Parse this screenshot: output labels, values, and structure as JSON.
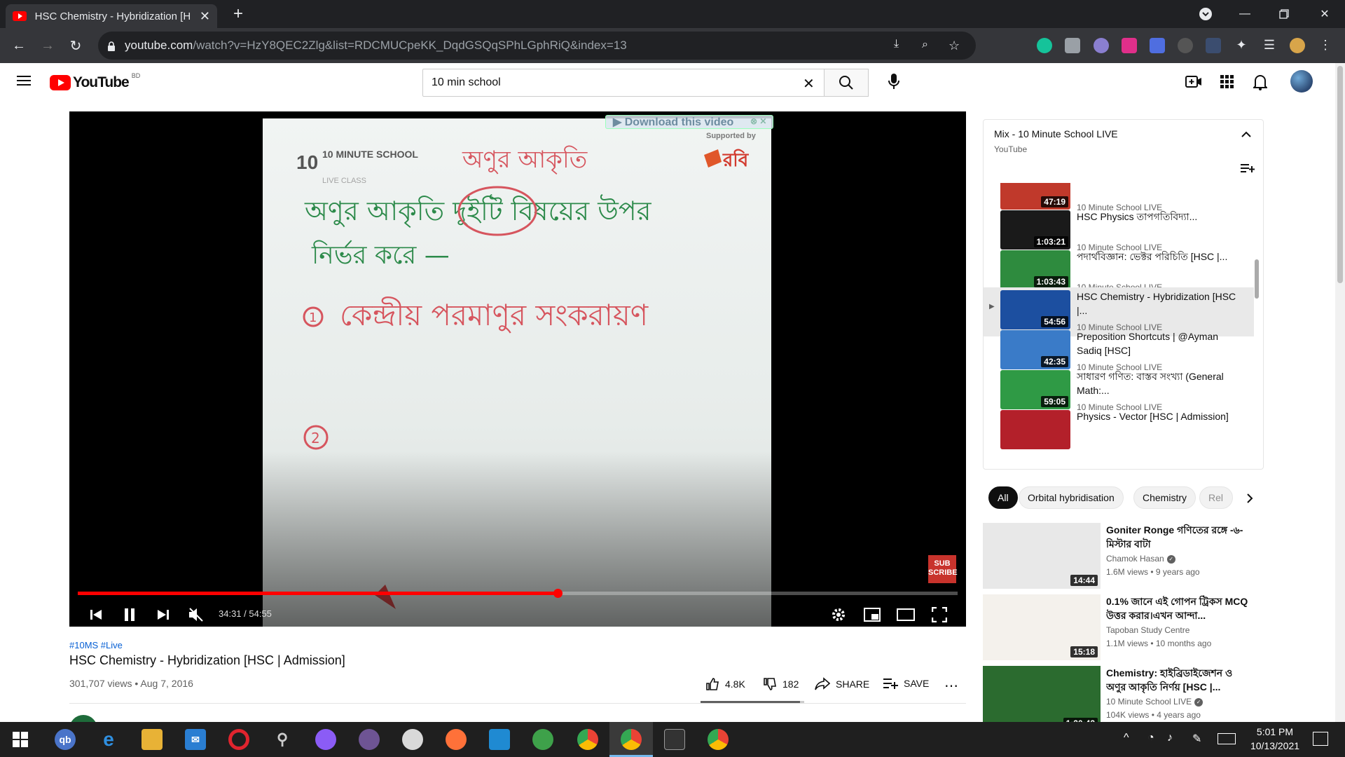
{
  "browser": {
    "tab_title": "HSC Chemistry - Hybridization [H",
    "url_host": "youtube.com",
    "url_path": "/watch?v=HzY8QEC2Zlg&list=RDCMUCpeKK_DqdGSQqSPhLGphRiQ&index=13"
  },
  "youtube": {
    "logo_text": "YouTube",
    "country_code": "BD",
    "search_value": "10 min school",
    "search_placeholder": "Search"
  },
  "player": {
    "download_text": "▶ Download this video",
    "current_time": "34:31 / 54:55",
    "progress": 0.545,
    "board_header_left": "10 MINUTE SCHOOL",
    "board_header_left_sub": "LIVE CLASS",
    "board_supported": "Supported by",
    "board_brand": "রবি",
    "board_title": "অণুর আকৃতি",
    "board_line1": "অণুর আকৃতি দুইটি বিষয়ের উপর",
    "board_line2": "নির্ভর করে —",
    "board_item1_num": "1",
    "board_item1": "কেন্দ্রীয় পরমাণুর সংকরায়ণ",
    "board_item2_num": "2",
    "subscribe_text": "SUB SCRIBE"
  },
  "video": {
    "tags": "#10MS #Live",
    "title": "HSC Chemistry - Hybridization [HSC | Admission]",
    "views_date": "301,707 views • Aug 7, 2016",
    "likes": "4.8K",
    "dislikes": "182",
    "share": "SHARE",
    "save": "SAVE",
    "like_ratio": 0.96
  },
  "playlist": {
    "title": "Mix - 10 Minute School LIVE",
    "subtitle": "YouTube",
    "items": [
      {
        "title": "",
        "duration": "47:19",
        "channel": "10 Minute School LIVE",
        "color": "#c0392b"
      },
      {
        "title": "HSC Physics তাপগতিবিদ্যা...",
        "duration": "1:03:21",
        "channel": "10 Minute School LIVE",
        "color": "#1a1a1a"
      },
      {
        "title": "পদার্থবিজ্ঞান: ভেক্টর পরিচিতি [HSC |...",
        "duration": "1:03:43",
        "channel": "10 Minute School LIVE",
        "color": "#2e8b3e"
      },
      {
        "title": "HSC Chemistry - Hybridization [HSC |...",
        "duration": "54:56",
        "channel": "10 Minute School LIVE",
        "color": "#1c4fa0"
      },
      {
        "title": "Preposition Shortcuts | @Ayman Sadiq [HSC]",
        "duration": "42:35",
        "channel": "10 Minute School LIVE",
        "color": "#3a7bc8"
      },
      {
        "title": "সাধারণ গণিত: বাস্তব সংখ্যা (General Math:...",
        "duration": "59:05",
        "channel": "10 Minute School LIVE",
        "color": "#2f9a45"
      },
      {
        "title": "Physics - Vector [HSC | Admission]",
        "duration": "",
        "channel": "",
        "color": "#b3202a"
      }
    ]
  },
  "chips": [
    "All",
    "Orbital hybridisation",
    "Chemistry",
    "Rel"
  ],
  "recommendations": [
    {
      "title": "Goniter Ronge গণিতের রঙ্গে -৬- মিস্টার বাটা",
      "channel": "Chamok Hasan",
      "stats": "1.6M views • 9 years ago",
      "duration": "14:44",
      "color": "#e8e8e8"
    },
    {
      "title": "0.1% জানে এই গোপন ট্রিকস MCQ উত্তর করার।এখন আন্দা...",
      "channel": "Tapoban Study Centre",
      "stats": "1.1M views • 10 months ago",
      "duration": "15:18",
      "color": "#f4f1ec"
    },
    {
      "title": "Chemistry: হাইব্রিডাইজেশন ও অণুর আকৃতি নির্ণয় [HSC |...",
      "channel": "10 Minute School LIVE",
      "stats": "104K views • 4 years ago",
      "duration": "1:20:42",
      "color": "#2b6b2f"
    }
  ],
  "taskbar": {
    "time": "5:01 PM",
    "date": "10/13/2021"
  }
}
